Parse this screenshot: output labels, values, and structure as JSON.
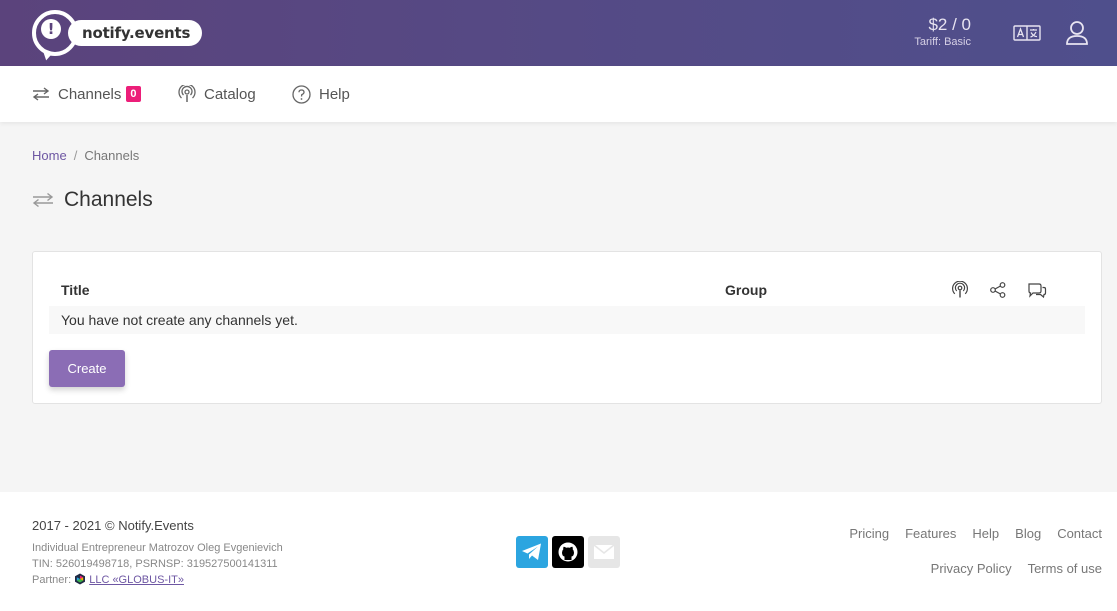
{
  "header": {
    "logo_text": "notify.events",
    "logo_mark": "!",
    "balance": "$2 / 0",
    "tariff": "Tariff: Basic",
    "lang_icon": "translate-icon",
    "user_icon": "user-icon"
  },
  "nav": {
    "items": [
      {
        "label": "Channels",
        "icon": "swap-arrows-icon",
        "badge": "0"
      },
      {
        "label": "Catalog",
        "icon": "podcast-icon"
      },
      {
        "label": "Help",
        "icon": "question-circle-icon"
      }
    ]
  },
  "breadcrumb": {
    "home": "Home",
    "separator": "/",
    "current": "Channels"
  },
  "page": {
    "title": "Channels"
  },
  "table": {
    "columns": [
      "Title",
      "Group"
    ],
    "column_icons": [
      "podcast-icon",
      "share-icon",
      "chat-icon"
    ],
    "empty_message": "You have not create any channels yet.",
    "create_label": "Create"
  },
  "footer": {
    "copyright": "2017 - 2021 © Notify.Events",
    "entrepreneur": "Individual Entrepreneur Matrozov Oleg Evgenievich",
    "tin": "TIN: 526019498718, PSRNSP: 319527500141311",
    "partner_label": "Partner:",
    "partner_name": "LLC «GLOBUS-IT»",
    "social": [
      "telegram-icon",
      "github-icon",
      "email-icon"
    ],
    "links_row1": [
      "Pricing",
      "Features",
      "Help",
      "Blog",
      "Contact"
    ],
    "links_row2": [
      "Privacy Policy",
      "Terms of use"
    ]
  },
  "colors": {
    "header_gradient_start": "#5b437c",
    "header_gradient_end": "#4f4f8c",
    "accent": "#8b6db5",
    "badge": "#ec1e79",
    "link": "#6e57a3",
    "telegram": "#2ca5e0",
    "github": "#000000",
    "email": "#e6e6e6"
  }
}
